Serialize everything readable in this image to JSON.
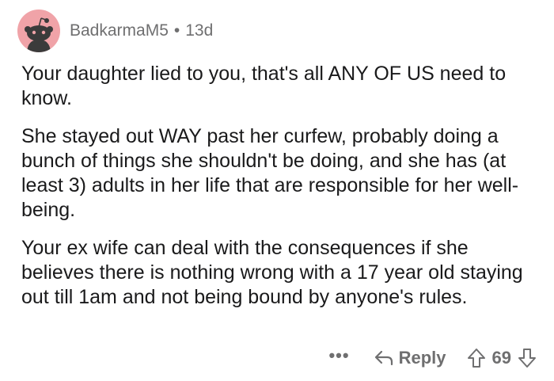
{
  "comment": {
    "author": "BadkarmaM5",
    "separator": "•",
    "age": "13d",
    "paragraphs": [
      "Your daughter lied to you, that's all ANY OF US need to know.",
      "She stayed out WAY past her curfew, probably doing a bunch of things she shouldn't be doing, and she has (at least 3) adults in her life that are responsible for her well-being.",
      "Your ex wife can deal with the consequences if she believes there is nothing wrong with a 17 year old staying out till 1am and not being bound by anyone's rules."
    ],
    "avatar_color": "#f0a3a8"
  },
  "actions": {
    "more_label": "•••",
    "reply_label": "Reply",
    "vote_count": "69",
    "icons": {
      "more": "more-dots-icon",
      "reply": "reply-arrow-icon",
      "upvote": "upvote-arrow-icon",
      "downvote": "downvote-arrow-icon"
    }
  }
}
